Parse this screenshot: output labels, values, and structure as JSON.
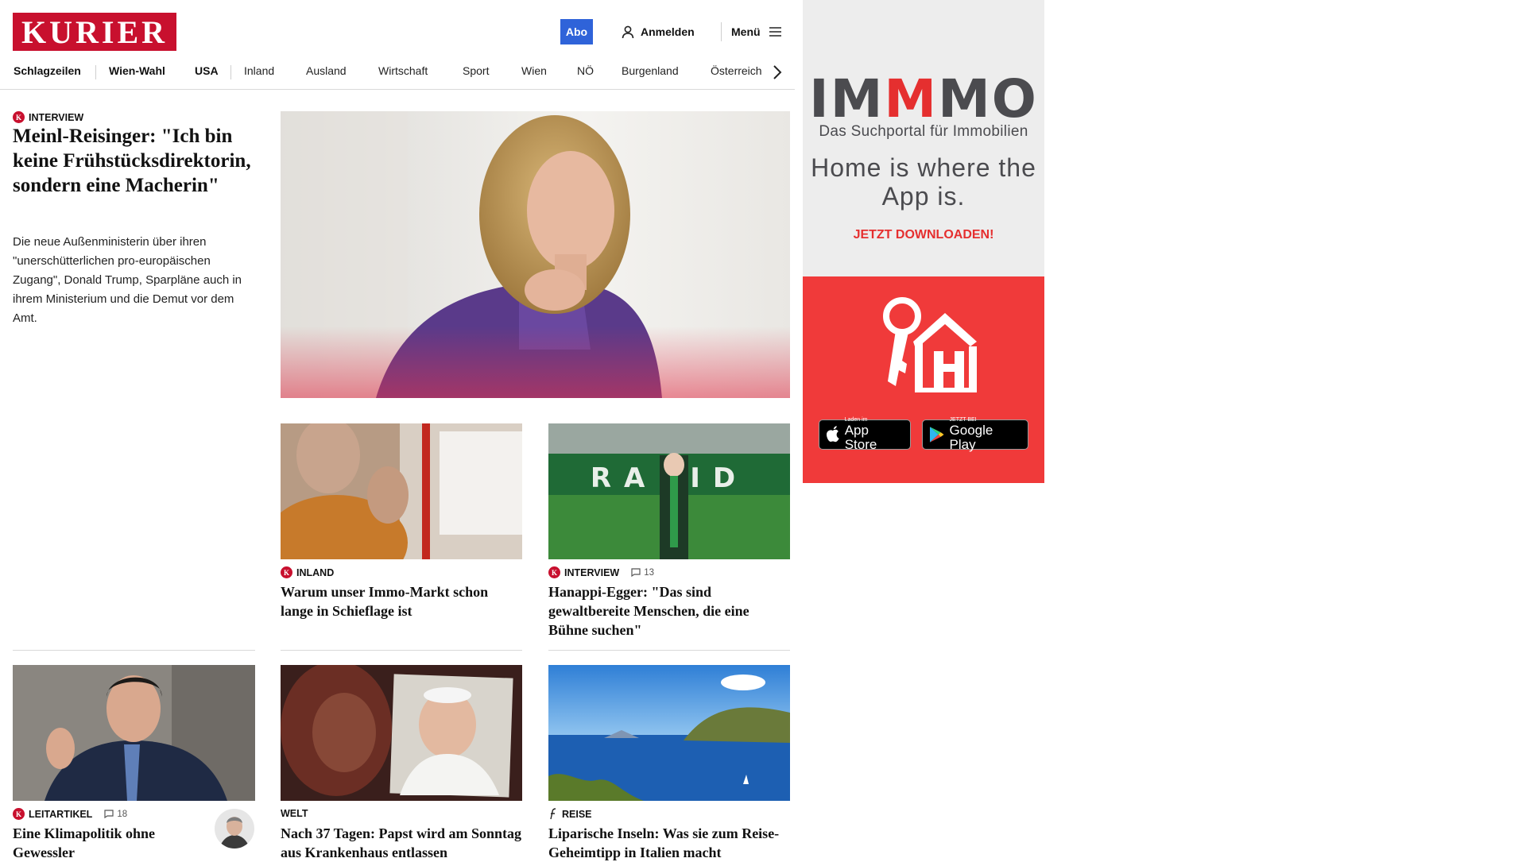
{
  "header": {
    "logo": "KURIER",
    "abo_label": "Abo",
    "login_label": "Anmelden",
    "menu_label": "Menü"
  },
  "nav": {
    "items": [
      "Schlagzeilen",
      "Wien-Wahl",
      "USA",
      "Inland",
      "Ausland",
      "Wirtschaft",
      "Sport",
      "Wien",
      "NÖ",
      "Burgenland",
      "Österreich"
    ]
  },
  "lead": {
    "kicker": "INTERVIEW",
    "title": "Meinl-Reisinger: \"Ich bin keine Frühstücksdirektorin, sondern eine Macherin\"",
    "teaser": "Die neue Außenministerin über ihren \"unerschütterlichen pro-europäischen Zugang\", Donald Trump, Sparpläne auch in ihrem Ministerium und die Demut vor dem Amt.",
    "badge": "K"
  },
  "cards": [
    {
      "kicker": "INLAND",
      "title": "Warum unser Immo-Markt schon lange in Schieflage ist",
      "comments": ""
    },
    {
      "kicker": "INTERVIEW",
      "title": "Hanappi-Egger: \"Das sind gewaltbereite Menschen, die eine Bühne suchen\"",
      "comments": "13",
      "stadium_text": "RAPID"
    },
    {
      "kicker": "LEITARTIKEL",
      "title": "Eine Klimapolitik ohne Gewessler",
      "comments": "18"
    },
    {
      "kicker": "WELT",
      "title": "Nach 37 Tagen: Papst wird am Sonntag aus Krankenhaus entlassen",
      "comments": ""
    },
    {
      "kicker": "REISE",
      "title": "Liparische Inseln: Was sie zum Reise-Geheimtipp in Italien macht",
      "comments": ""
    }
  ],
  "ad": {
    "brand_pre": "IM",
    "brand_accent": "M",
    "brand_post": "MO",
    "tagline": "Das Suchportal für Immobilien",
    "slogan": "Home is where the App is.",
    "cta": "JETZT DOWNLOADEN!",
    "appstore_small": "Laden im",
    "appstore_big": "App Store",
    "googleplay_small": "JETZT BEI",
    "googleplay_big": "Google Play"
  },
  "colors": {
    "brand_red": "#c8102e",
    "abo_blue": "#2f63d9",
    "ad_red": "#f03a3a",
    "ad_grey": "#4b4b4f"
  },
  "icons": [
    "user-icon",
    "hamburger-menu-icon",
    "chevron-right-icon",
    "comment-icon",
    "kurier-k-badge",
    "apple-icon",
    "google-play-icon",
    "house-key-icon",
    "freizeit-f-icon"
  ]
}
